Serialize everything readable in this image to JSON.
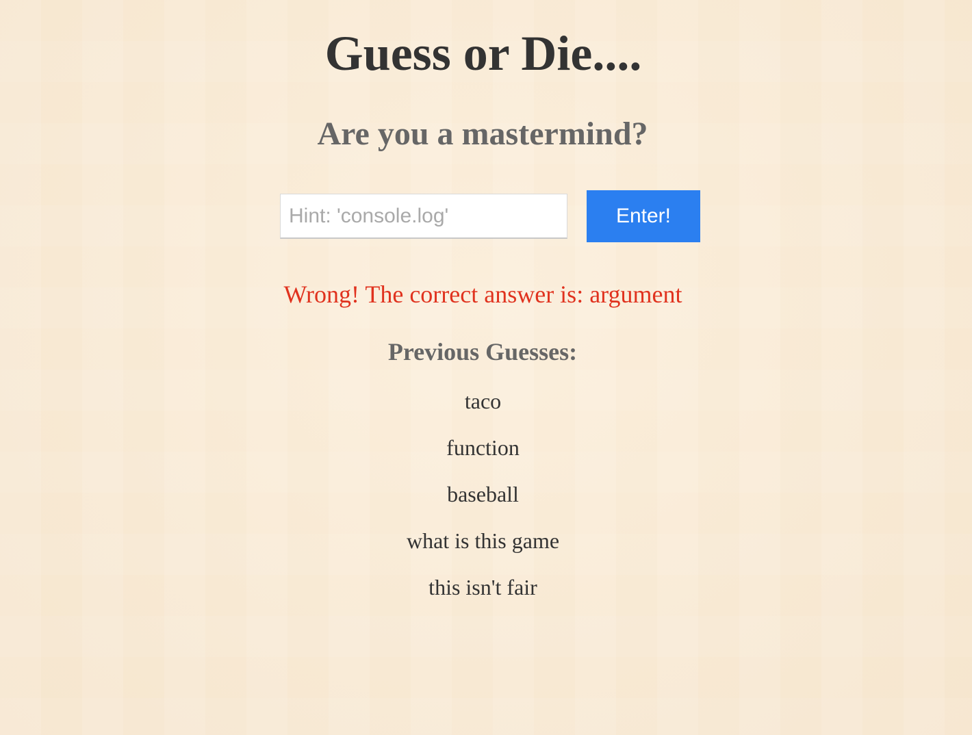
{
  "header": {
    "title": "Guess or Die....",
    "subtitle": "Are you a mastermind?"
  },
  "form": {
    "input_value": "",
    "input_placeholder": "Hint: 'console.log'",
    "enter_label": "Enter!"
  },
  "result": {
    "message": "Wrong! The correct answer is: argument",
    "color": "#e0321e"
  },
  "previous": {
    "heading": "Previous Guesses:",
    "guesses": [
      "taco",
      "function",
      "baseball",
      "what is this game",
      "this isn't fair"
    ]
  },
  "colors": {
    "background": "#f8ead6",
    "button": "#2b7ff0",
    "title_text": "#333333",
    "subtitle_text": "#666666"
  }
}
